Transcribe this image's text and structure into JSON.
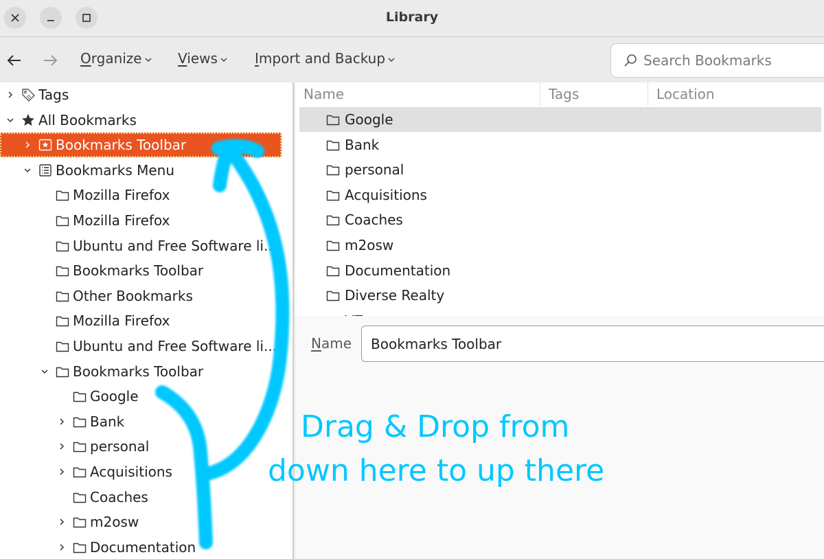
{
  "window": {
    "title": "Library",
    "controls": {
      "close": "close",
      "minimize": "minimize",
      "maximize": "maximize"
    }
  },
  "toolbar": {
    "back_icon": "arrow-left-icon",
    "forward_icon": "arrow-right-icon",
    "organize": {
      "accel": "O",
      "rest": "rganize"
    },
    "views": {
      "accel": "V",
      "rest": "iews"
    },
    "import_backup": {
      "accel": "I",
      "rest": "mport and Backup"
    },
    "search_placeholder": "Search Bookmarks"
  },
  "tree": [
    {
      "label": "Tags",
      "twisty": "collapsed",
      "icon": "tag-icon",
      "depth": 0
    },
    {
      "label": "All Bookmarks",
      "twisty": "expanded",
      "icon": "star-icon",
      "depth": 0
    },
    {
      "label": "Bookmarks Toolbar",
      "twisty": "collapsed",
      "icon": "bookmarks-toolbar-icon",
      "depth": 1,
      "selected": true
    },
    {
      "label": "Bookmarks Menu",
      "twisty": "expanded",
      "icon": "bookmarks-menu-icon",
      "depth": 1
    },
    {
      "label": "Mozilla Firefox",
      "twisty": "none",
      "icon": "folder-icon",
      "depth": 2
    },
    {
      "label": "Mozilla Firefox",
      "twisty": "none",
      "icon": "folder-icon",
      "depth": 2
    },
    {
      "label": "Ubuntu and Free Software li...",
      "twisty": "none",
      "icon": "folder-icon",
      "depth": 2
    },
    {
      "label": "Bookmarks Toolbar",
      "twisty": "none",
      "icon": "folder-icon",
      "depth": 2
    },
    {
      "label": "Other Bookmarks",
      "twisty": "none",
      "icon": "folder-icon",
      "depth": 2
    },
    {
      "label": "Mozilla Firefox",
      "twisty": "none",
      "icon": "folder-icon",
      "depth": 2
    },
    {
      "label": "Ubuntu and Free Software li...",
      "twisty": "none",
      "icon": "folder-icon",
      "depth": 2
    },
    {
      "label": "Bookmarks Toolbar",
      "twisty": "expanded",
      "icon": "folder-icon",
      "depth": 2
    },
    {
      "label": "Google",
      "twisty": "none",
      "icon": "folder-icon",
      "depth": 3
    },
    {
      "label": "Bank",
      "twisty": "collapsed",
      "icon": "folder-icon",
      "depth": 3
    },
    {
      "label": "personal",
      "twisty": "collapsed",
      "icon": "folder-icon",
      "depth": 3
    },
    {
      "label": "Acquisitions",
      "twisty": "collapsed",
      "icon": "folder-icon",
      "depth": 3
    },
    {
      "label": "Coaches",
      "twisty": "none",
      "icon": "folder-icon",
      "depth": 3
    },
    {
      "label": "m2osw",
      "twisty": "collapsed",
      "icon": "folder-icon",
      "depth": 3
    },
    {
      "label": "Documentation",
      "twisty": "collapsed",
      "icon": "folder-icon",
      "depth": 3
    }
  ],
  "list": {
    "columns": [
      "Name",
      "Tags",
      "Location"
    ],
    "rows": [
      {
        "name": "Google",
        "highlighted": true
      },
      {
        "name": "Bank"
      },
      {
        "name": "personal"
      },
      {
        "name": "Acquisitions"
      },
      {
        "name": "Coaches"
      },
      {
        "name": "m2osw"
      },
      {
        "name": "Documentation"
      },
      {
        "name": "Diverse Realty"
      },
      {
        "name": "VZ"
      }
    ]
  },
  "details": {
    "name_label": {
      "accel": "N",
      "rest": "ame"
    },
    "name_value": "Bookmarks Toolbar"
  },
  "annotation": {
    "line1": "Drag & Drop from",
    "line2": "down here to up there",
    "color": "#00c8ff"
  },
  "colors": {
    "selection": "#e95420",
    "selection_focus_ring": "#f6d28a",
    "row_highlight": "#e0e0e0"
  }
}
